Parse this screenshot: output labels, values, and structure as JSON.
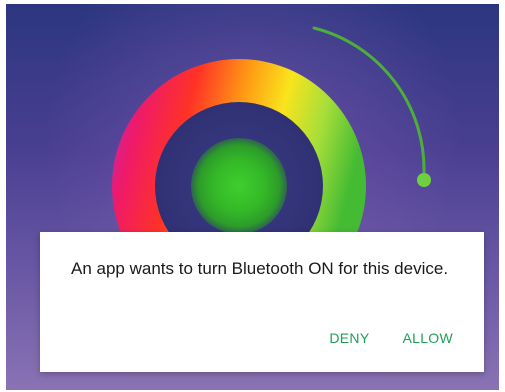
{
  "dialog": {
    "message": "An app wants to turn Bluetooth ON for this device.",
    "deny_label": "DENY",
    "allow_label": "ALLOW"
  },
  "color_wheel": {
    "selected_color": "#3fae2a",
    "accent_color": "#4caf3a",
    "icons": [
      "color-wheel",
      "selector-knob"
    ]
  },
  "colors": {
    "button_text": "#1f9e56",
    "message_text": "#1a1a1a",
    "background_top": "#2c3680",
    "background_bottom": "#8a73b4"
  }
}
